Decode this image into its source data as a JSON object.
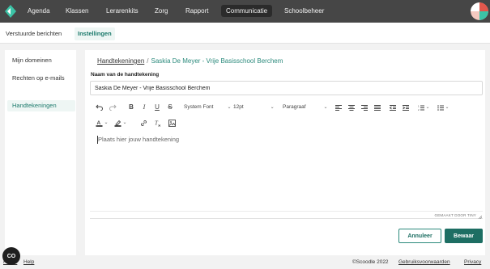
{
  "topnav": {
    "items": [
      "Agenda",
      "Klassen",
      "Lerarenkits",
      "Zorg",
      "Rapport",
      "Communicatie",
      "Schoolbeheer"
    ],
    "active": "Communicatie"
  },
  "subnav": {
    "tabs": [
      "Verstuurde berichten",
      "Instellingen"
    ],
    "active": "Instellingen"
  },
  "sidebar": {
    "items": [
      "Mijn domeinen",
      "Rechten op e-mails",
      "Handtekeningen"
    ],
    "active": "Handtekeningen"
  },
  "breadcrumb": {
    "parent": "Handtekeningen",
    "separator": "/",
    "current": "Saskia De Meyer - Vrije Basisschool Berchem"
  },
  "form": {
    "name_label": "Naam van de handtekening",
    "name_value": "Saskia De Meyer - Vrije Basisschool Berchem"
  },
  "editor": {
    "font_family": "System Font",
    "font_size": "12pt",
    "block_format": "Paragraaf",
    "placeholder": "Plaats hier jouw handtekening",
    "powered_by": "GEMAAKT DOOR TINY"
  },
  "actions": {
    "cancel": "Annuleer",
    "save": "Bewaar"
  },
  "footer": {
    "home": "Home",
    "help": "Help",
    "copyright": "©Scoodle 2022",
    "terms": "Gebruiksvoorwaarden",
    "privacy": "Privacy"
  },
  "chat_label": "CO",
  "colors": {
    "accent": "#2b8a7c",
    "save_bg": "#1d6e63",
    "topnav_bg": "#464646",
    "text_color_bar": "#222222",
    "highlight_bar": "#222222"
  }
}
